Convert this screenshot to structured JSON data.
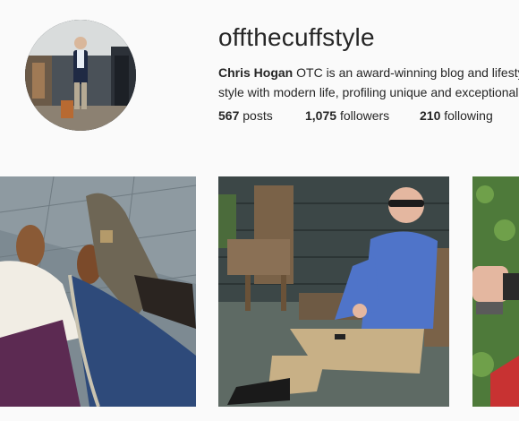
{
  "profile": {
    "username": "offthecuffstyle",
    "bio_name": "Chris Hogan",
    "bio_line1_rest": " OTC is an award-winning blog and lifestyle",
    "bio_line2": "style with modern life, profiling unique and exceptional",
    "stats": [
      {
        "count": "567",
        "label": "posts"
      },
      {
        "count": "1,075",
        "label": "followers"
      },
      {
        "count": "210",
        "label": "following"
      }
    ]
  },
  "posts": [
    {
      "icon": "photo-shoes-feet"
    },
    {
      "icon": "photo-man-on-bench"
    },
    {
      "icon": "photo-partial-man-watch"
    }
  ],
  "colors": {
    "background": "#fafafa",
    "text": "#262626"
  }
}
